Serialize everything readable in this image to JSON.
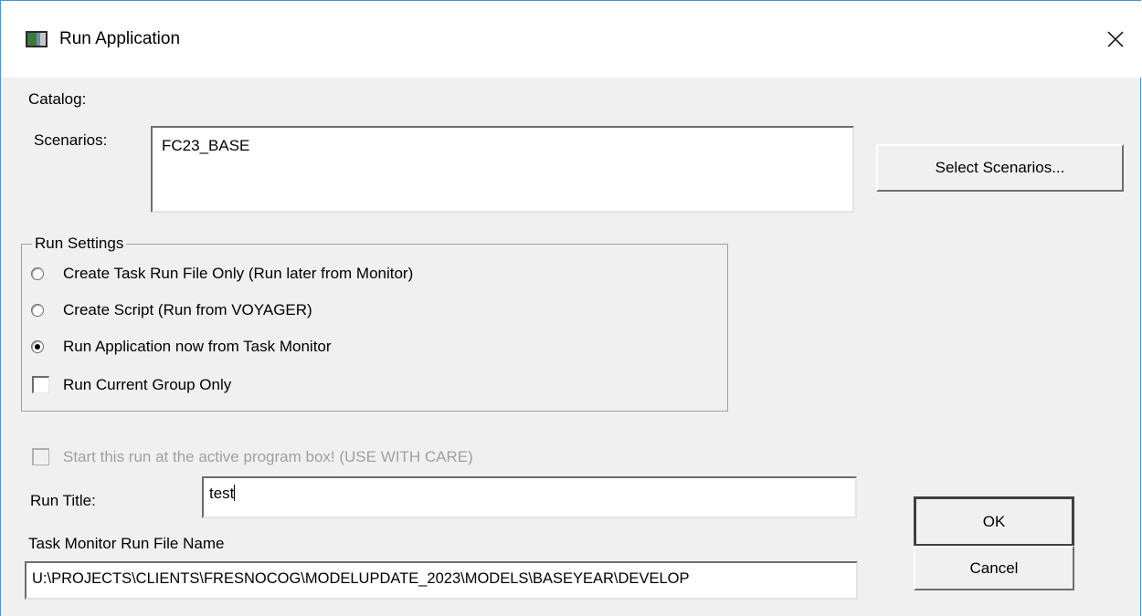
{
  "window": {
    "title": "Run Application",
    "icon": "app-window-icon",
    "close_icon": "close-icon"
  },
  "catalog": {
    "label": "Catalog:"
  },
  "scenarios": {
    "label": "Scenarios:",
    "value": "FC23_BASE",
    "select_button": "Select Scenarios..."
  },
  "run_settings": {
    "legend": "Run Settings",
    "options": [
      {
        "label": "Create Task Run File Only (Run later from Monitor)",
        "checked": false
      },
      {
        "label": "Create Script (Run from VOYAGER)",
        "checked": false
      },
      {
        "label": "Run Application now  from Task Monitor",
        "checked": true
      }
    ],
    "current_group_only": {
      "label": "Run Current Group Only",
      "checked": false
    }
  },
  "start_active": {
    "label": "Start this run at the active program box! (USE WITH CARE)",
    "checked": false,
    "enabled": false
  },
  "run_title": {
    "label": "Run Title:",
    "value": "test"
  },
  "run_file": {
    "label": "Task Monitor Run File Name",
    "value": "U:\\PROJECTS\\CLIENTS\\FRESNOCOG\\MODELUPDATE_2023\\MODELS\\BASEYEAR\\DEVELOP"
  },
  "buttons": {
    "ok": "OK",
    "cancel": "Cancel"
  }
}
